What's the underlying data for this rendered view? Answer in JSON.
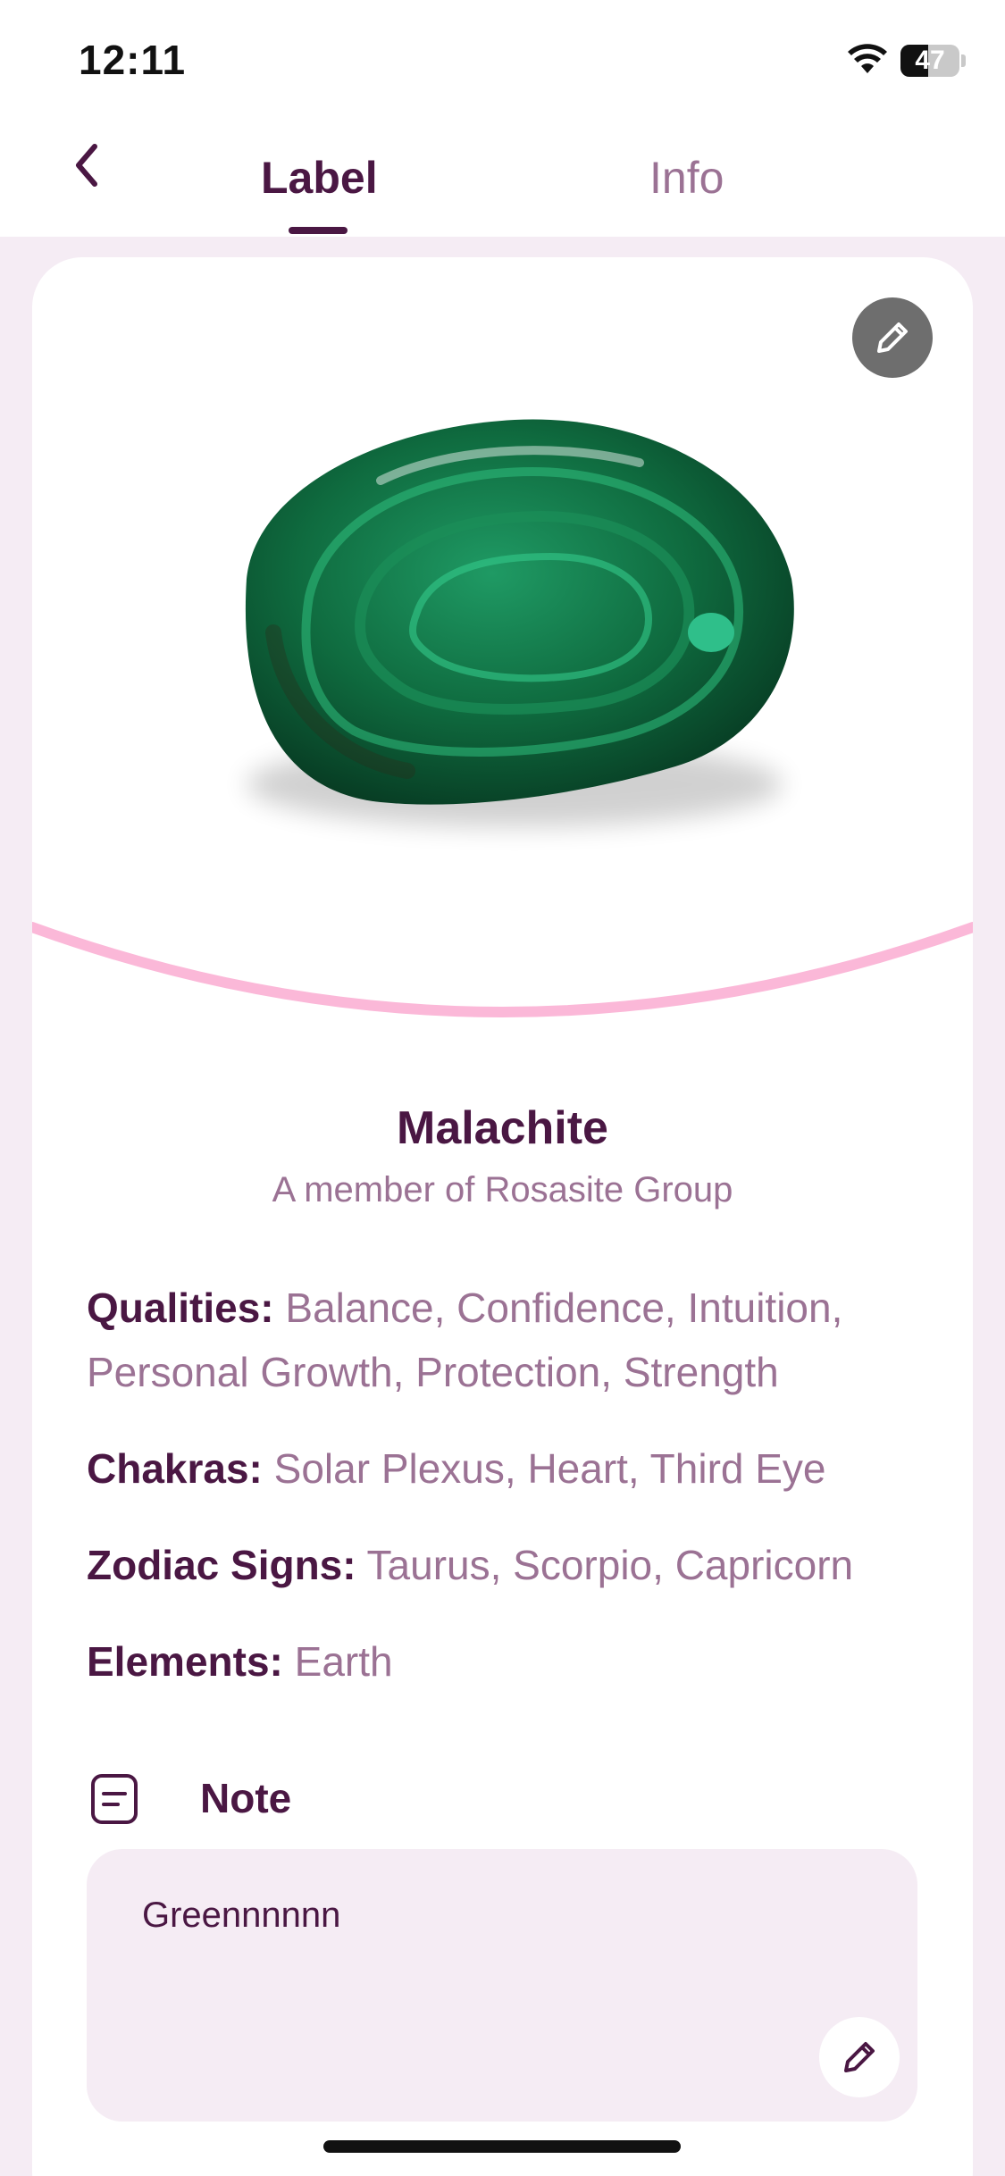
{
  "status_bar": {
    "time": "12:11",
    "battery": "47",
    "battery_level": 0.47
  },
  "tabs": [
    {
      "label": "Label",
      "active": true
    },
    {
      "label": "Info",
      "active": false
    }
  ],
  "stone": {
    "name": "Malachite",
    "group": "A member of Rosasite Group"
  },
  "properties": [
    {
      "key": "Qualities:",
      "value": " Balance, Confidence, Intuition, Personal Growth, Protection, Strength"
    },
    {
      "key": "Chakras:",
      "value": " Solar Plexus, Heart, Third Eye"
    },
    {
      "key": "Zodiac Signs:",
      "value": " Taurus, Scorpio, Capricorn"
    },
    {
      "key": "Elements:",
      "value": " Earth"
    }
  ],
  "note": {
    "title": "Note",
    "text": "Greennnnnn"
  },
  "colors": {
    "primary": "#4a1743",
    "secondary_text": "#9b7294",
    "background": "#f5ecf4",
    "arc": "#fbb8d8"
  },
  "icons": [
    "back-chevron-icon",
    "wifi-icon",
    "pencil-icon",
    "note-icon"
  ]
}
